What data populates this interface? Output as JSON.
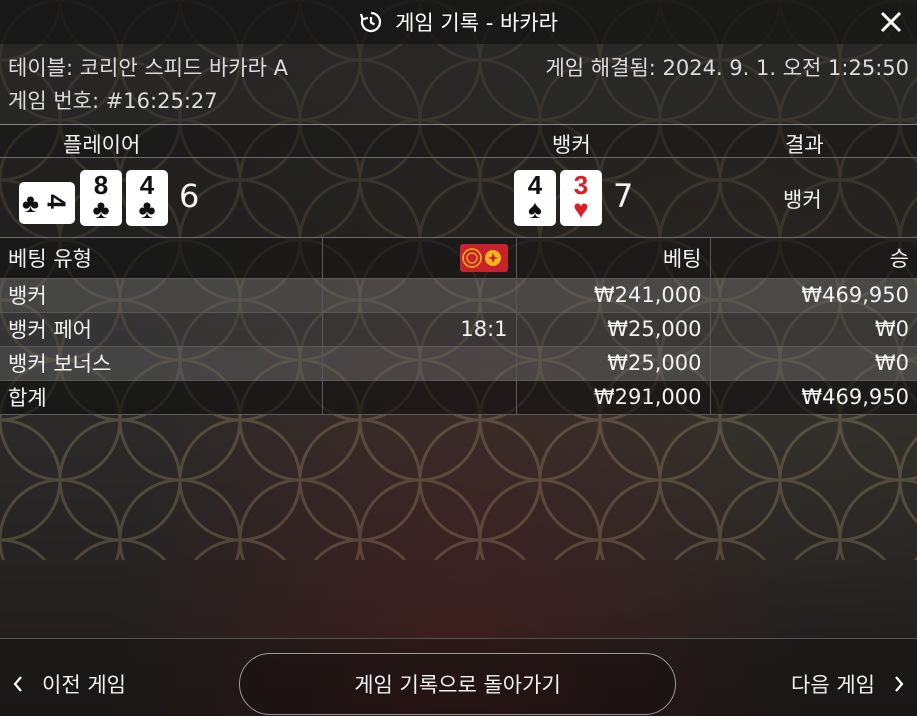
{
  "title": "게임 기록 - 바카라",
  "info": {
    "table": "테이블: 코리안 스피드 바카라 A",
    "game_no": "게임 번호: #16:25:27",
    "resolved": "게임 해결됨: 2024. 9. 1. 오전 1:25:50"
  },
  "headers": {
    "player": "플레이어",
    "banker": "뱅커",
    "result": "결과"
  },
  "player": {
    "cards": [
      {
        "rank": "4",
        "suit": "♣",
        "sideways": true
      },
      {
        "rank": "8",
        "suit": "♣"
      },
      {
        "rank": "4",
        "suit": "♣"
      }
    ],
    "score": "6"
  },
  "banker": {
    "cards": [
      {
        "rank": "4",
        "suit": "♠"
      },
      {
        "rank": "3",
        "suit": "♥",
        "color": "#e01b24"
      }
    ],
    "score": "7"
  },
  "result": "뱅커",
  "bets_table": {
    "columns": [
      "베팅 유형",
      "",
      "베팅",
      "승"
    ],
    "rows": [
      {
        "type": "뱅커",
        "odds": "",
        "bet": "₩241,000",
        "win": "₩469,950"
      },
      {
        "type": "뱅커 페어",
        "odds": "18:1",
        "bet": "₩25,000",
        "win": "₩0"
      },
      {
        "type": "뱅커 보너스",
        "odds": "",
        "bet": "₩25,000",
        "win": "₩0"
      }
    ],
    "total": {
      "type": "합계",
      "bet": "₩291,000",
      "win": "₩469,950"
    }
  },
  "footer": {
    "prev": "이전 게임",
    "back": "게임 기록으로 돌아가기",
    "next": "다음 게임"
  },
  "icons": {
    "history": "history-icon",
    "close": "close-icon",
    "side_bet": "side-bet-chip-icon",
    "prev": "chevron-left-icon",
    "next": "chevron-right-icon"
  },
  "colors": {
    "red_suit": "#e01b24",
    "chip": "#c8232c",
    "chip_accent": "#f2b71c"
  }
}
